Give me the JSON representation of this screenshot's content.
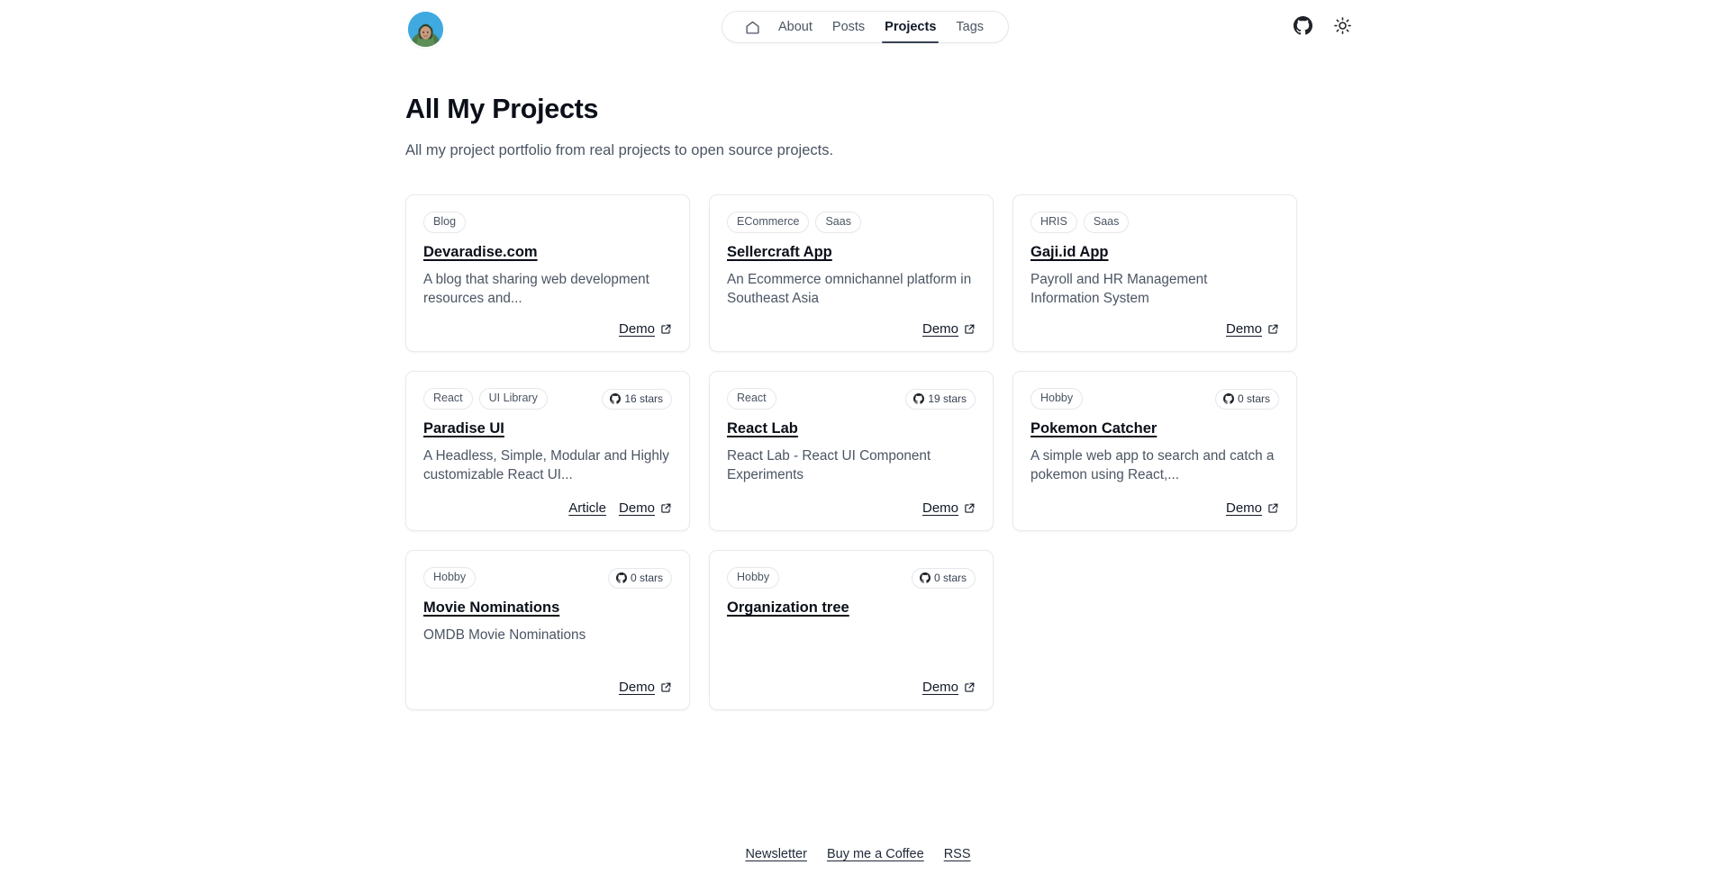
{
  "header": {
    "avatar_alt": "profile-avatar",
    "nav": {
      "home_icon": "home-icon",
      "items": [
        {
          "label": "About",
          "active": false
        },
        {
          "label": "Posts",
          "active": false
        },
        {
          "label": "Projects",
          "active": true
        },
        {
          "label": "Tags",
          "active": false
        }
      ]
    },
    "actions": [
      {
        "icon": "github-icon",
        "label": "GitHub"
      },
      {
        "icon": "sun-icon",
        "label": "Toggle theme"
      }
    ]
  },
  "main": {
    "title": "All My Projects",
    "subtitle": "All my project portfolio from real projects to open source projects.",
    "projects": [
      {
        "tags": [
          "Blog"
        ],
        "stars": null,
        "title": "Devaradise.com",
        "description": "A blog that sharing web development resources and...",
        "links": [
          {
            "label": "Demo",
            "icon": "external-link-icon"
          }
        ]
      },
      {
        "tags": [
          "ECommerce",
          "Saas"
        ],
        "stars": null,
        "title": "Sellercraft App",
        "description": "An Ecommerce omnichannel platform in Southeast Asia",
        "links": [
          {
            "label": "Demo",
            "icon": "external-link-icon"
          }
        ]
      },
      {
        "tags": [
          "HRIS",
          "Saas"
        ],
        "stars": null,
        "title": "Gaji.id App",
        "description": "Payroll and HR Management Information System",
        "links": [
          {
            "label": "Demo",
            "icon": "external-link-icon"
          }
        ]
      },
      {
        "tags": [
          "React",
          "UI Library"
        ],
        "stars": "16 stars",
        "title": "Paradise UI",
        "description": "A Headless, Simple, Modular and Highly customizable React UI...",
        "links": [
          {
            "label": "Article",
            "icon": null
          },
          {
            "label": "Demo",
            "icon": "external-link-icon"
          }
        ]
      },
      {
        "tags": [
          "React"
        ],
        "stars": "19 stars",
        "title": "React Lab",
        "description": "React Lab - React UI Component Experiments",
        "links": [
          {
            "label": "Demo",
            "icon": "external-link-icon"
          }
        ]
      },
      {
        "tags": [
          "Hobby"
        ],
        "stars": "0 stars",
        "title": "Pokemon Catcher",
        "description": "A simple web app to search and catch a pokemon using React,...",
        "links": [
          {
            "label": "Demo",
            "icon": "external-link-icon"
          }
        ]
      },
      {
        "tags": [
          "Hobby"
        ],
        "stars": "0 stars",
        "title": "Movie Nominations",
        "description": "OMDB Movie Nominations",
        "links": [
          {
            "label": "Demo",
            "icon": "external-link-icon"
          }
        ]
      },
      {
        "tags": [
          "Hobby"
        ],
        "stars": "0 stars",
        "title": "Organization tree",
        "description": "",
        "links": [
          {
            "label": "Demo",
            "icon": "external-link-icon"
          }
        ]
      }
    ]
  },
  "footer": {
    "links": [
      "Newsletter",
      "Buy me a Coffee",
      "RSS"
    ]
  },
  "colors": {
    "background": "#ffffff",
    "text": "#111827",
    "muted": "#4b5563",
    "border": "#e5e7eb",
    "accent": "#374151"
  }
}
